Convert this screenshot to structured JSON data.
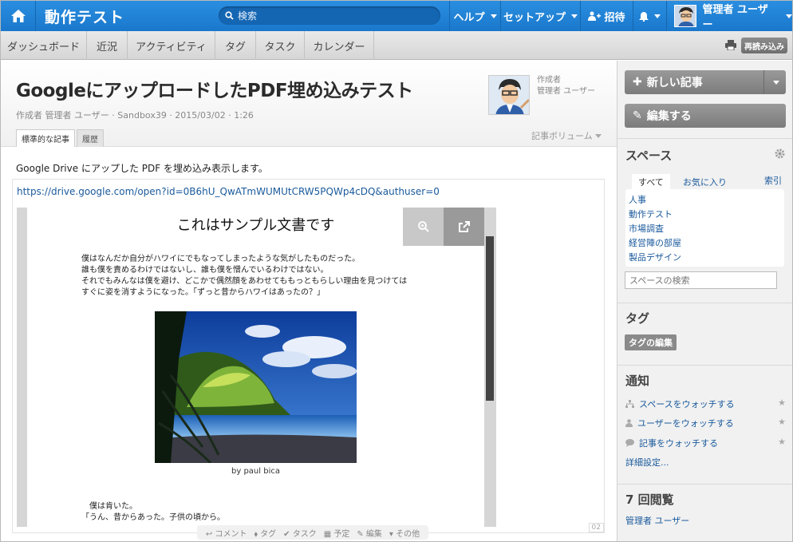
{
  "topbar": {
    "app_title": "動作テスト",
    "search_placeholder": "検索",
    "help": "ヘルプ",
    "setup": "セットアップ",
    "invite": "招待",
    "user": "管理者 ユーザー"
  },
  "subnav": {
    "items": [
      "ダッシュボード",
      "近況",
      "アクティビティ",
      "タグ",
      "タスク",
      "カレンダー"
    ],
    "reload": "再読み込み"
  },
  "article": {
    "title": "GoogleにアップロードしたPDF埋め込みテスト",
    "meta": "作成者 管理者 ユーザー · Sandbox39 · 2015/03/02 · 1:26",
    "author_label": "作成者",
    "author_name": "管理者 ユーザー",
    "tabs": [
      "標準的な記事",
      "履歴"
    ],
    "volume": "記事ボリューム",
    "body": "Google Drive にアップした PDF を埋め込み表示します。",
    "link": "https://drive.google.com/open?id=0B6hU_QwATmWUMUtCRW5PQWp4cDQ&authuser=0",
    "page_num": "02"
  },
  "pdf": {
    "title": "これはサンプル文書です",
    "para1": [
      "僕はなんだか自分がハワイにでもなってしまったような気がしたものだった。",
      "誰も僕を責めるわけではないし、誰も僕を憎んでいるわけではない。",
      "それでもみんなは僕を避け、どこかで偶然顔をあわせてももっともらしい理由を見つけては",
      "すぐに姿を消すようになった。「ずっと昔からハワイはあったの？」"
    ],
    "credit": "by paul bica",
    "para2": [
      "僕は肯いた。",
      "「うん、昔からあった。子供の頃から。"
    ]
  },
  "toolbar": {
    "items": [
      "コメント",
      "タグ",
      "タスク",
      "予定",
      "編集",
      "その他"
    ]
  },
  "sidebar": {
    "new_article": "新しい記事",
    "edit": "編集する",
    "spaces_title": "スペース",
    "tab_all": "すべて",
    "tab_fav": "お気に入り",
    "index": "索引",
    "spaces": [
      "人事",
      "動作テスト",
      "市場調査",
      "経営陣の部屋",
      "製品デザイン"
    ],
    "space_search": "スペースの検索",
    "tags_title": "タグ",
    "tags_edit": "タグの編集",
    "notify_title": "通知",
    "notify": [
      "スペースをウォッチする",
      "ユーザーをウォッチする",
      "記事をウォッチする"
    ],
    "notify_more": "詳細設定...",
    "views_title": "7 回閲覧",
    "viewer": "管理者 ユーザー"
  },
  "colors": {
    "topbar": "#1a78cc",
    "link": "#1a5a9c"
  }
}
